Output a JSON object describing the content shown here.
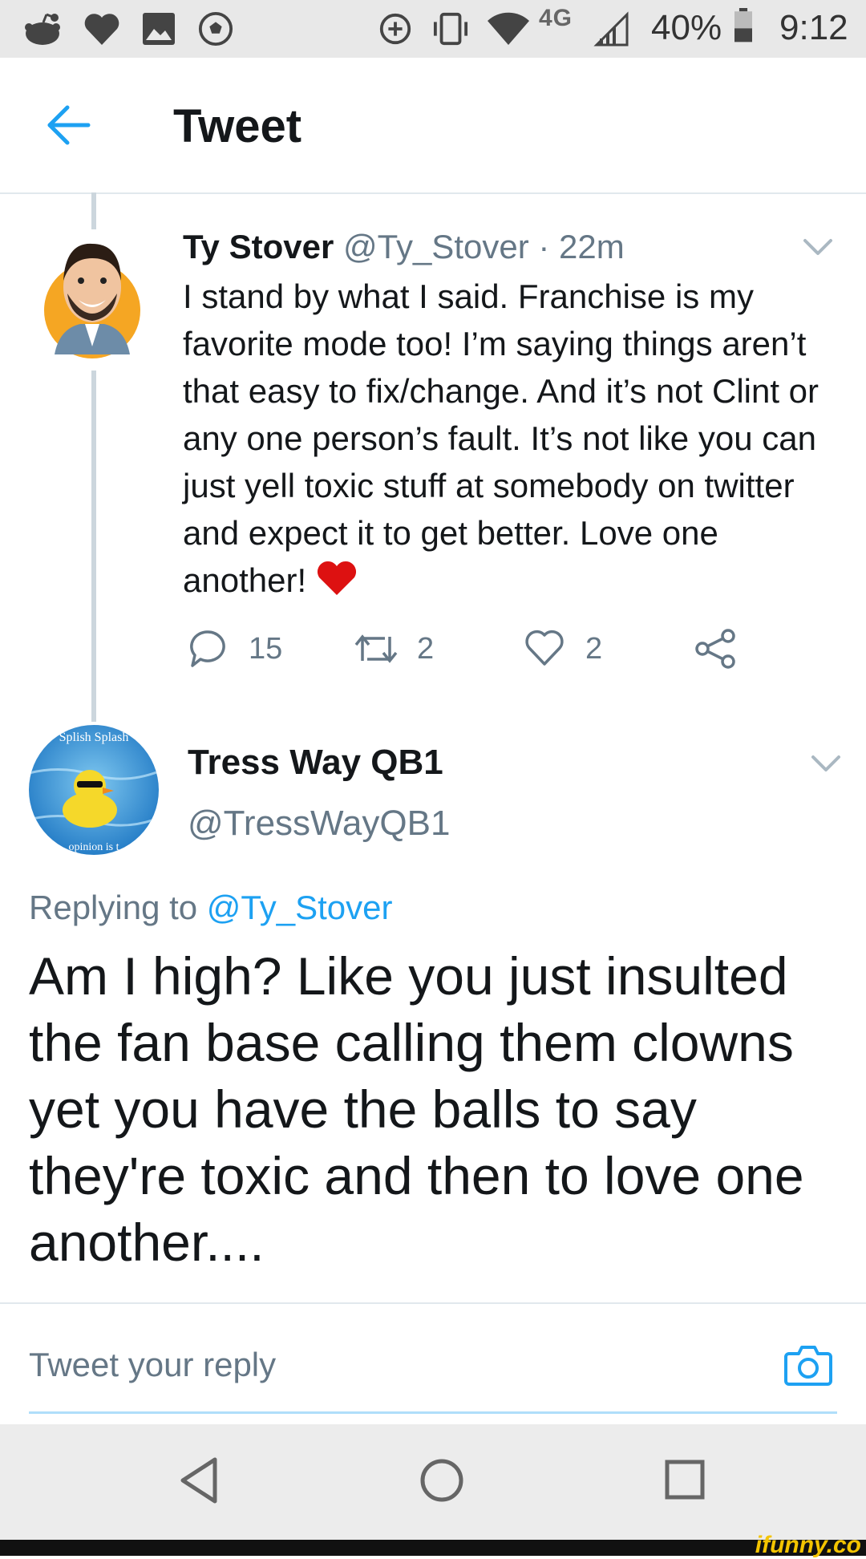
{
  "status_bar": {
    "network": "4G",
    "battery": "40%",
    "time": "9:12",
    "icons": [
      "reddit-icon",
      "heart-icon",
      "image-icon",
      "soccer-ball-icon",
      "data-saver-icon",
      "vibrate-icon",
      "wifi-icon",
      "signal-icon",
      "battery-icon"
    ]
  },
  "header": {
    "title": "Tweet",
    "back_icon": "arrow-left-icon"
  },
  "tweets": [
    {
      "name": "Ty Stover",
      "handle": "@Ty_Stover",
      "separator": "·",
      "time": "22m",
      "text": "I stand by what I said. Franchise is my favorite mode too! I’m saying things aren’t that easy to fix/change. And it’s not Clint or any one person’s fault. It’s not like you can just yell toxic stuff at somebody on twitter and expect it to get better. Love one another!",
      "emoji": "red-heart-emoji",
      "actions": {
        "replies": "15",
        "retweets": "2",
        "likes": "2"
      }
    },
    {
      "name": "Tress Way QB1",
      "handle": "@TressWayQB1",
      "replying_prefix": "Replying to",
      "replying_to": "@Ty_Stover",
      "text": "Am I high? Like you just insulted the fan base calling them clowns yet you have the balls to say they're toxic and then to love one another....",
      "avatar_text_top": "Splish Splash",
      "avatar_text_bottom": "opinion is t"
    }
  ],
  "reply_bar": {
    "placeholder": "Tweet your reply",
    "icon": "camera-icon"
  },
  "nav_bar": {
    "icons": [
      "back-triangle-icon",
      "home-circle-icon",
      "recents-square-icon"
    ]
  },
  "watermark": "ifunny.co",
  "colors": {
    "accent": "#1da1f2",
    "muted": "#657786",
    "text": "#14171a",
    "divider": "#e1e8ed",
    "heart": "#e0245e"
  }
}
